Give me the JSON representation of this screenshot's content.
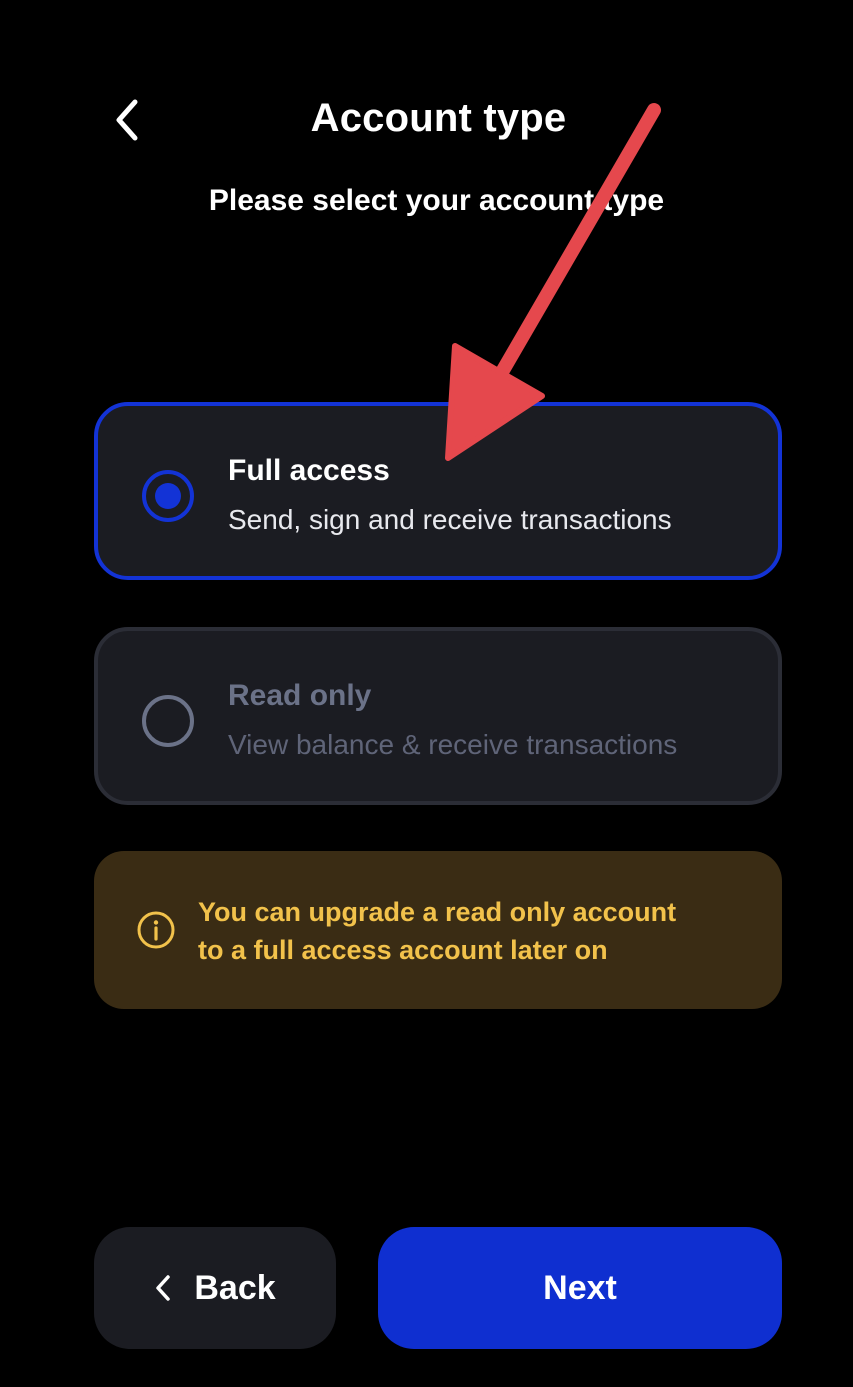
{
  "header": {
    "back_icon": "chevron-left-icon",
    "title": "Account type",
    "subtitle": "Please select your account type"
  },
  "options": [
    {
      "title": "Full access",
      "description": "Send, sign and receive transactions",
      "selected": true
    },
    {
      "title": "Read only",
      "description": "View balance & receive transactions",
      "selected": false
    }
  ],
  "info": {
    "icon": "info-icon",
    "line1": "You can upgrade a read only account",
    "line2": "to a full access account later on"
  },
  "buttons": {
    "back_label": "Back",
    "next_label": "Next"
  },
  "colors": {
    "background": "#000000",
    "accent": "#1333d6",
    "card": "#1b1c22",
    "warning_bg": "#3a2c14",
    "warning_text": "#f2c24b",
    "annotation_arrow": "#e5484d"
  }
}
